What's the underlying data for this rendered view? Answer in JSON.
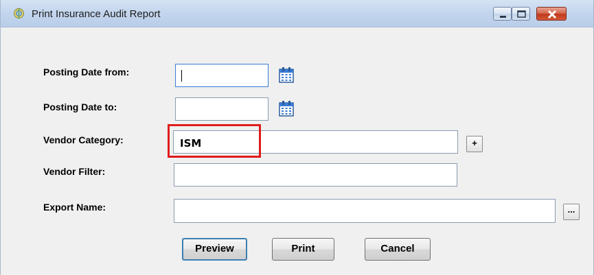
{
  "window": {
    "title": "Print Insurance Audit Report",
    "icon": "app-icon",
    "controls": {
      "minimize": "minimize-icon",
      "maximize": "maximize-icon",
      "close": "close-icon"
    }
  },
  "form": {
    "posting_date_from": {
      "label": "Posting Date from:",
      "value": "",
      "icon": "calendar-icon"
    },
    "posting_date_to": {
      "label": "Posting Date to:",
      "value": "",
      "icon": "calendar-icon"
    },
    "vendor_category": {
      "label": "Vendor Category:",
      "value": "ISM",
      "add_button": "+"
    },
    "vendor_filter": {
      "label": "Vendor Filter:",
      "value": ""
    },
    "export_name": {
      "label": "Export Name:",
      "value": "",
      "browse_button": "..."
    }
  },
  "buttons": {
    "preview": "Preview",
    "print": "Print",
    "cancel": "Cancel"
  },
  "colors": {
    "highlight": "#e01b1b",
    "titlebar": "#c4d6ee",
    "focus_border": "#3a7bd5"
  }
}
